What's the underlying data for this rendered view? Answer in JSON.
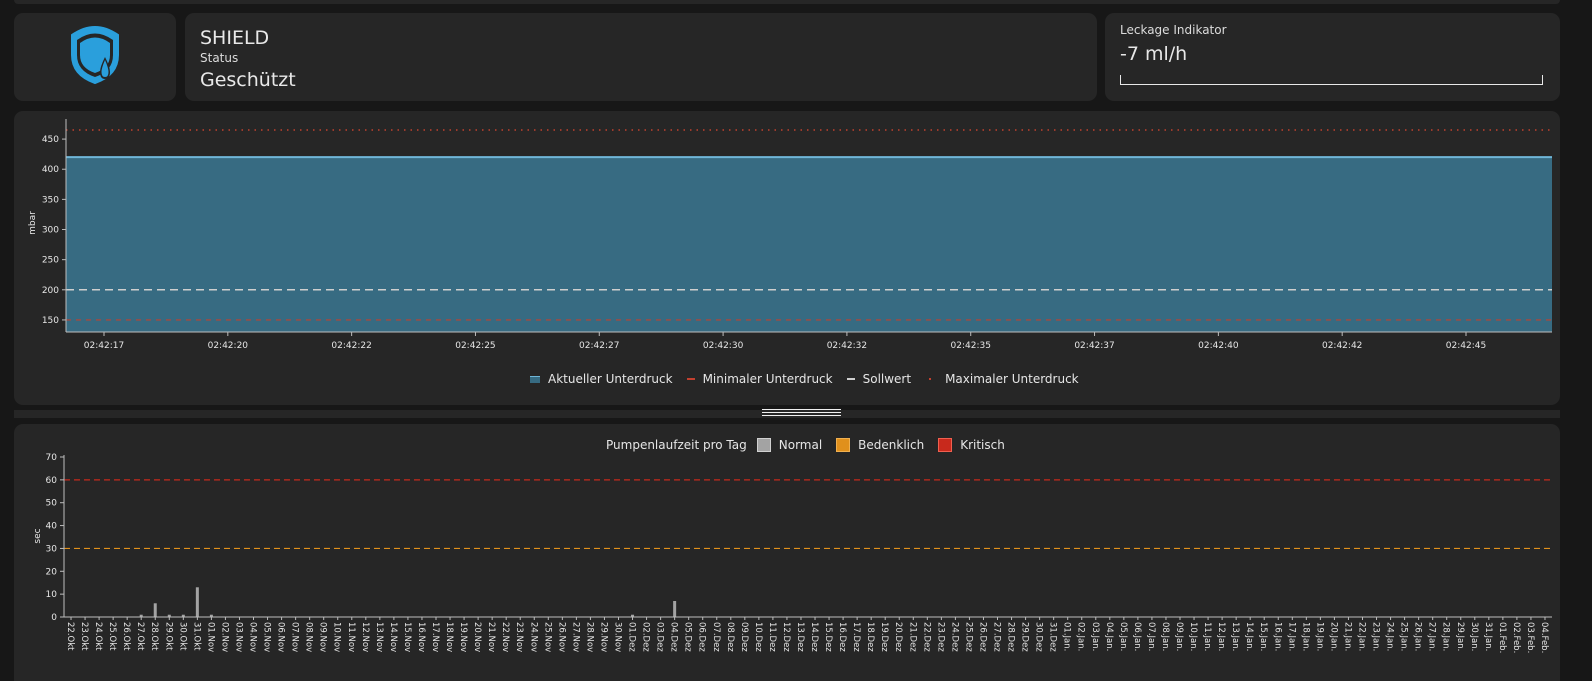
{
  "device": {
    "name": "SHIELD",
    "status_label": "Status",
    "status_value": "Geschützt"
  },
  "leak": {
    "label": "Leckage Indikator",
    "value": "-7 ml/h",
    "level": 0
  },
  "colors": {
    "pressure_fill": "#376b82",
    "pressure_line": "#6fb6d8",
    "min": "#c2402f",
    "max": "#c2402f",
    "setpoint": "#cfcfcf",
    "normal": "#a3a3a3",
    "warning": "#e0901c",
    "critical": "#c8291c",
    "logo": "#2a9fdc"
  },
  "pressure_chart": {
    "ylabel": "mbar",
    "yticks": [
      150,
      200,
      250,
      300,
      350,
      400,
      450
    ],
    "legend": {
      "current": "Aktueller Unterdruck",
      "min": "Minimaler Unterdruck",
      "setpoint": "Sollwert",
      "max": "Maximaler Unterdruck"
    }
  },
  "pump_chart": {
    "ylabel": "sec",
    "legend": {
      "title": "Pumpenlaufzeit pro Tag",
      "normal": "Normal",
      "warning": "Bedenklich",
      "critical": "Kritisch"
    }
  },
  "chart_data": [
    {
      "type": "area",
      "x": [
        "02:42:17",
        "02:42:20",
        "02:42:22",
        "02:42:25",
        "02:42:27",
        "02:42:30",
        "02:42:32",
        "02:42:35",
        "02:42:37",
        "02:42:40",
        "02:42:42",
        "02:42:45"
      ],
      "series": [
        {
          "name": "Aktueller Unterdruck",
          "values": [
            420,
            420,
            420,
            420,
            420,
            420,
            420,
            420,
            420,
            420,
            420,
            420
          ]
        },
        {
          "name": "Minimaler Unterdruck",
          "values": [
            150,
            150,
            150,
            150,
            150,
            150,
            150,
            150,
            150,
            150,
            150,
            150
          ]
        },
        {
          "name": "Sollwert",
          "values": [
            200,
            200,
            200,
            200,
            200,
            200,
            200,
            200,
            200,
            200,
            200,
            200
          ]
        },
        {
          "name": "Maximaler Unterdruck",
          "values": [
            465,
            465,
            465,
            465,
            465,
            465,
            465,
            465,
            465,
            465,
            465,
            465
          ]
        }
      ],
      "ylabel": "mbar",
      "ylim": [
        130,
        480
      ],
      "legend_position": "bottom"
    },
    {
      "type": "bar",
      "categories": [
        "22.Okt",
        "23.Okt",
        "24.Okt",
        "25.Okt",
        "26.Okt",
        "27.Okt",
        "28.Okt",
        "29.Okt",
        "30.Okt",
        "31.Okt",
        "01.Nov",
        "02.Nov",
        "03.Nov",
        "04.Nov",
        "05.Nov",
        "06.Nov",
        "07.Nov",
        "08.Nov",
        "09.Nov",
        "10.Nov",
        "11.Nov",
        "12.Nov",
        "13.Nov",
        "14.Nov",
        "15.Nov",
        "16.Nov",
        "17.Nov",
        "18.Nov",
        "19.Nov",
        "20.Nov",
        "21.Nov",
        "22.Nov",
        "23.Nov",
        "24.Nov",
        "25.Nov",
        "26.Nov",
        "27.Nov",
        "28.Nov",
        "29.Nov",
        "30.Nov",
        "01.Dez",
        "02.Dez",
        "03.Dez",
        "04.Dez",
        "05.Dez",
        "06.Dez",
        "07.Dez",
        "08.Dez",
        "09.Dez",
        "10.Dez",
        "11.Dez",
        "12.Dez",
        "13.Dez",
        "14.Dez",
        "15.Dez",
        "16.Dez",
        "17.Dez",
        "18.Dez",
        "19.Dez",
        "20.Dez",
        "21.Dez",
        "22.Dez",
        "23.Dez",
        "24.Dez",
        "25.Dez",
        "26.Dez",
        "27.Dez",
        "28.Dez",
        "29.Dez",
        "30.Dez",
        "31.Dez",
        "01.Jan.",
        "02.Jan.",
        "03.Jan.",
        "04.Jan.",
        "05.Jan.",
        "06.Jan.",
        "07.Jan.",
        "08.Jan.",
        "09.Jan.",
        "10.Jan.",
        "11.Jan.",
        "12.Jan.",
        "13.Jan.",
        "14.Jan.",
        "15.Jan.",
        "16.Jan.",
        "17.Jan.",
        "18.Jan.",
        "19.Jan.",
        "20.Jan.",
        "21.Jan.",
        "22.Jan.",
        "23.Jan.",
        "24.Jan.",
        "25.Jan.",
        "26.Jan.",
        "27.Jan.",
        "28.Jan.",
        "29.Jan.",
        "30.Jan.",
        "31.Jan.",
        "01.Feb.",
        "02.Feb.",
        "03.Feb.",
        "04.Feb."
      ],
      "values": [
        0,
        0,
        0,
        0,
        0,
        1,
        6,
        1,
        1,
        13,
        1,
        0,
        0,
        0,
        0,
        0,
        0,
        0,
        0,
        0,
        0,
        0,
        0,
        0,
        0,
        0,
        0,
        0,
        0,
        0,
        0,
        0,
        0,
        0,
        0,
        0,
        0,
        0,
        0,
        0,
        1,
        0,
        0,
        7,
        0,
        0,
        0,
        0,
        0,
        0,
        0,
        0,
        0,
        0,
        0,
        0,
        0,
        0,
        0,
        0,
        0,
        0,
        0,
        0,
        0,
        0,
        0,
        0,
        0,
        0,
        0,
        0,
        0,
        0,
        0,
        0,
        0,
        0,
        0,
        0,
        0,
        0,
        0,
        0,
        0,
        0,
        0,
        0,
        0,
        0,
        0,
        0,
        0,
        0,
        0,
        0,
        0,
        0,
        0,
        0,
        0,
        0,
        0,
        0,
        0,
        0
      ],
      "ylabel": "sec",
      "ylim": [
        0,
        70
      ],
      "yticks": [
        0,
        10,
        20,
        30,
        40,
        50,
        60,
        70
      ],
      "thresholds": {
        "warning": 30,
        "critical": 60
      },
      "legend_position": "top"
    }
  ]
}
